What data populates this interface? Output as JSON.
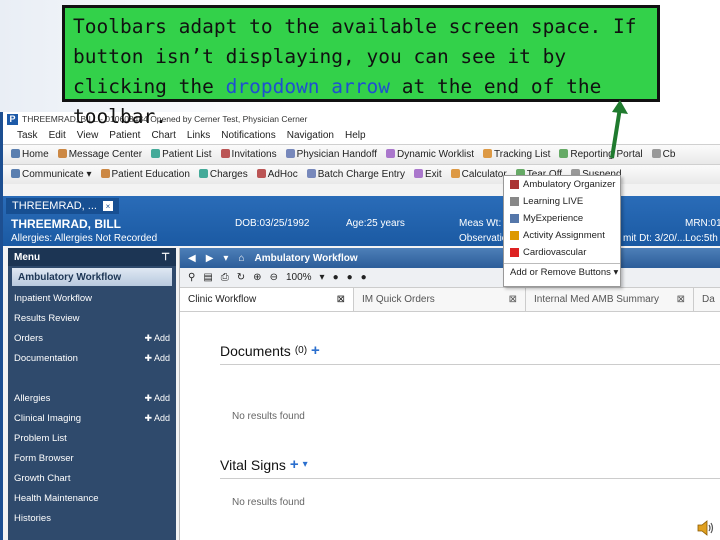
{
  "callout": {
    "text_before": "Toolbars adapt to the available screen space.  If button isn’t displaying, you can see it by clicking the ",
    "link_text": "dropdown arrow",
    "text_after": " at the end of the toolbar."
  },
  "window": {
    "title": "THREEMRAD, BILL - 010608484 Opened by Cerner Test, Physician Cerner"
  },
  "menubar": [
    "Task",
    "Edit",
    "View",
    "Patient",
    "Chart",
    "Links",
    "Notifications",
    "Navigation",
    "Help"
  ],
  "toolbar1": [
    "Home",
    "Message Center",
    "Patient List",
    "Invitations",
    "Physician Handoff",
    "Dynamic Worklist",
    "Tracking List",
    "Reporting Portal",
    "Cb"
  ],
  "toolbar2": [
    "Communicate ▾",
    "Patient Education",
    "Charges",
    "AdHoc",
    "Batch Charge Entry",
    "Exit",
    "Calculator",
    "Tear Off",
    "Suspend"
  ],
  "dropdown": {
    "items": [
      "Ambulatory Organizer",
      "Learning LIVE",
      "MyExperience",
      "Activity Assignment",
      "Cardiovascular"
    ],
    "footer": "Add or Remove Buttons ▾"
  },
  "patient": {
    "tab": "THREEMRAD, ...",
    "close": "×",
    "name": "THREEMRAD, BILL",
    "allergies": "Allergies: Allergies Not Recorded",
    "dob": "DOB:03/25/1992",
    "age": "Age:25 years",
    "meas": "Meas Wt:",
    "observation": "Observation",
    "mrn": "MRN:01",
    "loc": "Loc:5th",
    "admit": "mit Dt: 3/20/..."
  },
  "sidebar": {
    "menu_label": "Menu",
    "pin": "⊤",
    "workflow": "Ambulatory Workflow",
    "items": [
      {
        "label": "Inpatient Workflow",
        "add": ""
      },
      {
        "label": "Results Review",
        "add": ""
      },
      {
        "label": "Orders",
        "add": "Add"
      },
      {
        "label": "Documentation",
        "add": "Add"
      },
      {
        "label": "",
        "add": ""
      },
      {
        "label": "Allergies",
        "add": "Add"
      },
      {
        "label": "Clinical Imaging",
        "add": "Add"
      },
      {
        "label": "Problem List",
        "add": ""
      },
      {
        "label": "Form Browser",
        "add": ""
      },
      {
        "label": "Growth Chart",
        "add": ""
      },
      {
        "label": "Health Maintenance",
        "add": ""
      },
      {
        "label": "Histories",
        "add": ""
      }
    ]
  },
  "content": {
    "title": "Ambulatory Workflow",
    "zoom": "100%",
    "tabs": [
      "Clinic Workflow",
      "IM Quick Orders",
      "Internal Med AMB Summary",
      "Da"
    ],
    "documents_title": "Documents",
    "documents_count": "(0)",
    "no_results": "No results found",
    "vitals_title": "Vital Signs"
  },
  "colors": {
    "callout_bg": "#33d14a",
    "arrow": "#1f7a2e",
    "header_blue": "#1b5aa3"
  }
}
